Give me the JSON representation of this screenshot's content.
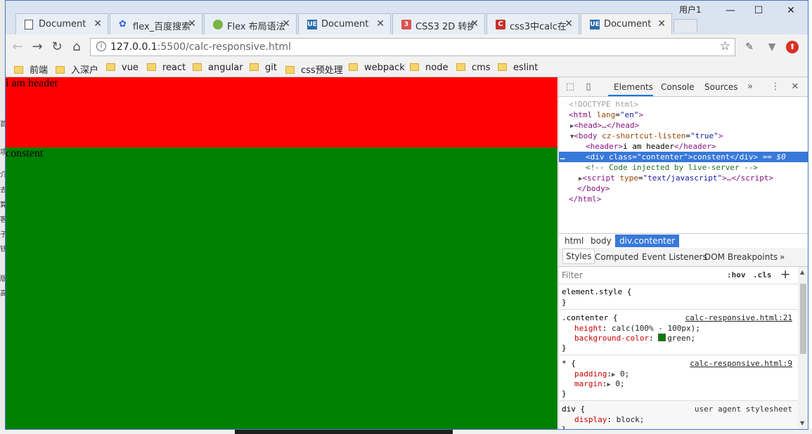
{
  "user": "用户1",
  "tabs": [
    {
      "label": "Document",
      "icon": "page-icon"
    },
    {
      "label": "flex_百度搜索",
      "icon": "baidu-icon"
    },
    {
      "label": "Flex 布局语法",
      "icon": "flex-icon"
    },
    {
      "label": "Document",
      "icon": "ue-icon"
    },
    {
      "label": "CSS3 2D 转换",
      "icon": "css-icon"
    },
    {
      "label": "css3中calc在",
      "icon": "c-icon"
    },
    {
      "label": "Document",
      "icon": "ue-icon",
      "active": true
    }
  ],
  "address": {
    "host": "127.0.0.1",
    "rest": ":5500/calc-responsive.html"
  },
  "bookmarks": [
    "前端",
    "入深户",
    "vue",
    "react",
    "angular",
    "git",
    "css预处理",
    "webpack",
    "node",
    "cms",
    "eslint"
  ],
  "page": {
    "header_text": "i am header",
    "content_text": "constent"
  },
  "devtools": {
    "tabs": [
      "Elements",
      "Console",
      "Sources"
    ],
    "dom": {
      "doctype": "<!DOCTYPE html>",
      "html_open": "<html",
      "html_attr": "lang",
      "html_val": "\"en\"",
      "head": "<head>…</head>",
      "body_open": "<body",
      "body_attr": "cz-shortcut-listen",
      "body_val": "\"true\"",
      "header_text": "i am header",
      "div_class": "\"contenter\"",
      "div_text": "constent",
      "div_suffix": "== $0",
      "comment": "<!-- Code injected by live-server -->",
      "script_attr": "type",
      "script_val": "\"text/javascript\"",
      "body_close": "</body>",
      "html_close": "</html>"
    },
    "breadcrumbs": [
      "html",
      "body",
      "div.contenter"
    ],
    "style_tabs": [
      "Styles",
      "Computed",
      "Event Listeners",
      "DOM Breakpoints"
    ],
    "filter": {
      "placeholder": "Filter",
      "hov": ":hov",
      "cls": ".cls"
    },
    "rules": {
      "element_style": "element.style {",
      "contenter_selector": ".contenter {",
      "contenter_source": "calc-responsive.html:21",
      "height_name": "height",
      "height_value": "calc(100% - 100px);",
      "bg_name": "background-color",
      "bg_value": "green;",
      "star_selector": "* {",
      "star_source": "calc-responsive.html:9",
      "padding_name": "padding",
      "padding_value": "0;",
      "margin_name": "margin",
      "margin_value": "0;",
      "div_selector": "div {",
      "div_source": "user agent stylesheet",
      "display_name": "display",
      "display_value": "block;"
    }
  },
  "colors": {
    "header_bg": "#ff0000",
    "content_bg": "#008000",
    "selection": "#3879d9"
  }
}
